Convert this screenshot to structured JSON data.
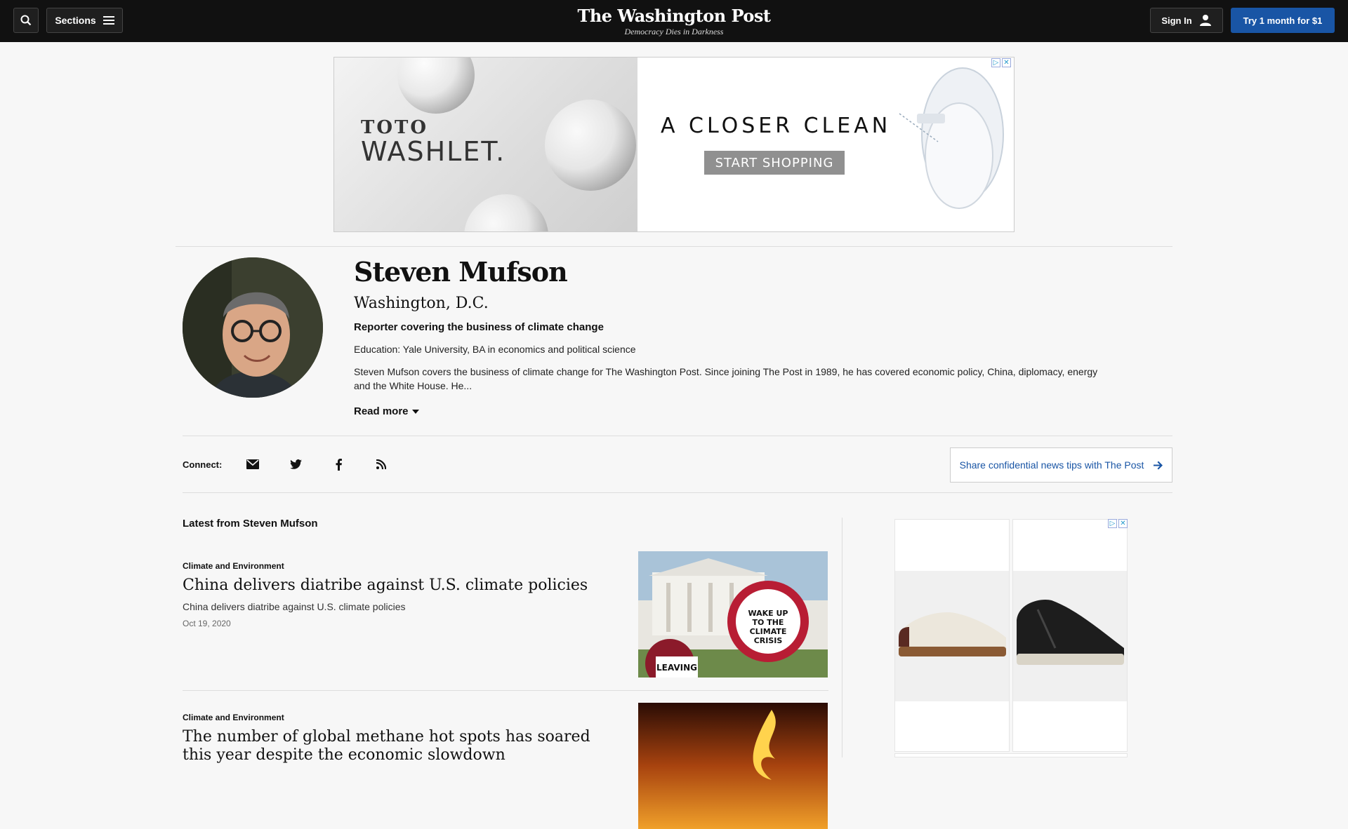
{
  "header": {
    "sections_label": "Sections",
    "logo_name": "The Washington Post",
    "logo_tagline": "Democracy Dies in Darkness",
    "sign_in_label": "Sign In",
    "subscribe_label": "Try 1 month for $1"
  },
  "top_ad": {
    "brand": "TOTO",
    "product": "WASHLET.",
    "headline": "A CLOSER CLEAN",
    "cta": "START SHOPPING"
  },
  "author": {
    "name": "Steven Mufson",
    "location": "Washington, D.C.",
    "role": "Reporter covering the business of climate change",
    "education": "Education: Yale University, BA in economics and political science",
    "bio": "Steven Mufson covers the business of climate change for The Washington Post. Since joining The Post in 1989, he has covered economic policy, China, diplomacy, energy and the White House. He...",
    "read_more": "Read more"
  },
  "connect": {
    "label": "Connect:",
    "icons": [
      "email-icon",
      "twitter-icon",
      "facebook-icon",
      "rss-icon"
    ],
    "tips_label": "Share confidential news tips with The Post"
  },
  "latest": {
    "title": "Latest from Steven Mufson",
    "stories": [
      {
        "kicker": "Climate and Environment",
        "headline": "China delivers diatribe against U.S. climate policies",
        "dek": "China delivers diatribe against U.S. climate policies",
        "date": "Oct 19, 2020",
        "sign_text": "WAKE UP TO THE CLIMATE CRISIS",
        "sign_text_2": "LEAVING"
      },
      {
        "kicker": "Climate and Environment",
        "headline": "The number of global methane hot spots has soared this year despite the economic slowdown"
      }
    ]
  },
  "colors": {
    "topbar": "#111111",
    "accent_blue": "#1955a5",
    "page_bg": "#f7f7f7"
  }
}
